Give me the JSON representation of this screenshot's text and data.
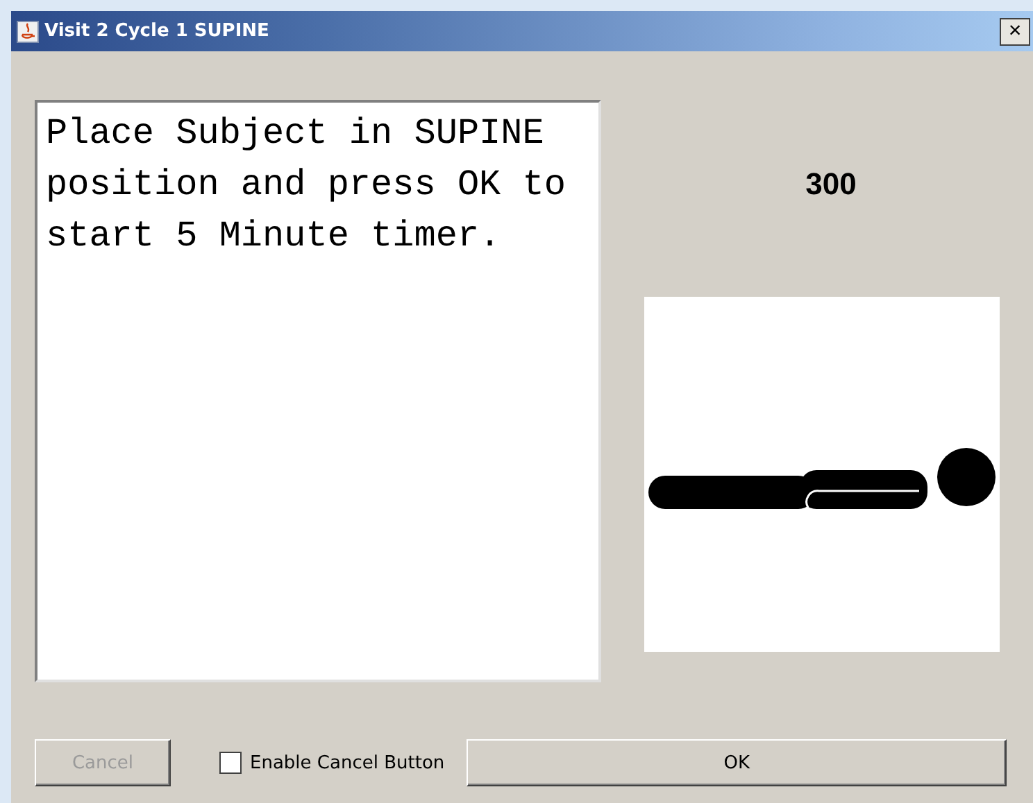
{
  "window": {
    "title": "Visit 2 Cycle 1 SUPINE",
    "close": "×"
  },
  "instructions": "Place Subject in SUPINE position and press OK to start 5 Minute timer.",
  "timer": "300",
  "position_image": {
    "kind": "supine"
  },
  "cancel_button": {
    "label": "Cancel",
    "disabled": true
  },
  "enable_cancel": {
    "label": "Enable Cancel Button",
    "checked": false
  },
  "ok_button": {
    "label": "OK",
    "disabled": false
  }
}
